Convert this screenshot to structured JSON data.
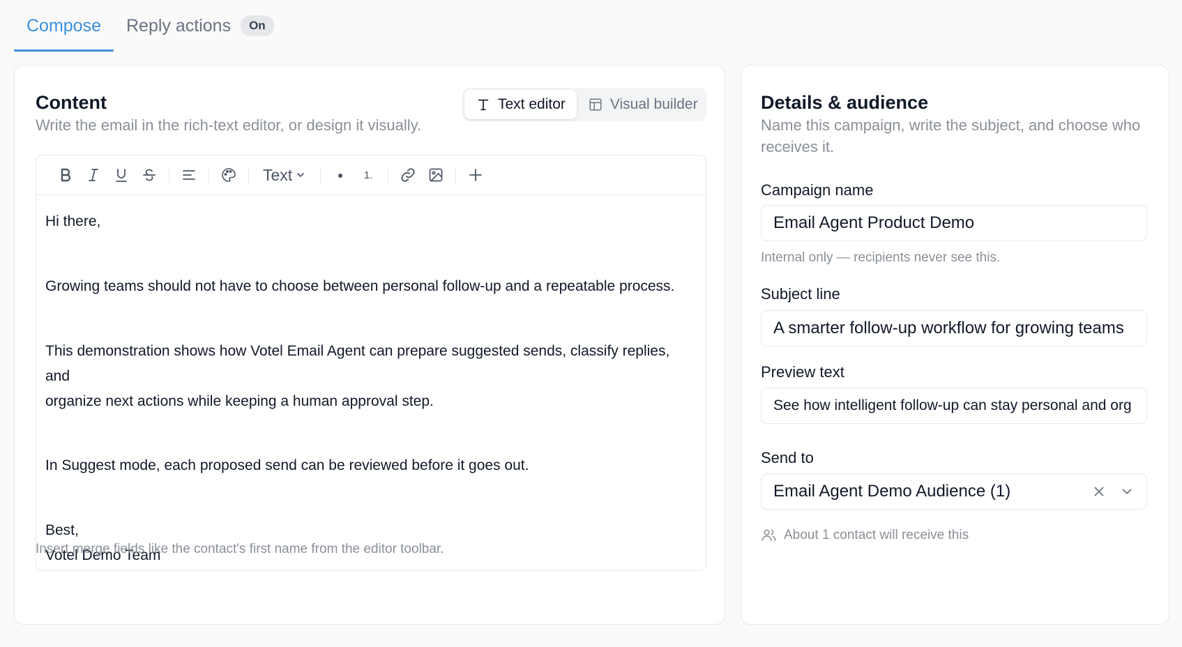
{
  "tabs": {
    "compose": "Compose",
    "reply_actions": "Reply actions",
    "reply_badge": "On"
  },
  "content": {
    "title": "Content",
    "subtitle": "Write the email in the rich-text editor, or design it visually.",
    "modes": {
      "text_editor": "Text editor",
      "visual_builder": "Visual builder",
      "active": "text_editor"
    },
    "toolbar": {
      "text_style": "Text",
      "ordered_list": "1."
    },
    "body": {
      "greeting": "Hi there,",
      "p1": "Growing teams should not have to choose between personal follow-up and a repeatable process.",
      "p2_line1": "This demonstration shows how Votel Email Agent can prepare suggested sends, classify replies, and",
      "p2_line2": "organize next actions while keeping a human approval step.",
      "p3": "In Suggest mode, each proposed send can be reviewed before it goes out.",
      "signoff": "Best,",
      "signature": "Votel Demo Team"
    },
    "hint": "Insert merge fields like the contact's first name from the editor toolbar."
  },
  "details": {
    "title": "Details & audience",
    "subtitle": "Name this campaign, write the subject, and choose who receives it.",
    "campaign_name": {
      "label": "Campaign name",
      "value": "Email Agent Product Demo",
      "hint": "Internal only — recipients never see this."
    },
    "subject_line": {
      "label": "Subject line",
      "value": "A smarter follow-up workflow for growing teams"
    },
    "preview_text": {
      "label": "Preview text",
      "value": "See how intelligent follow-up can stay personal and org"
    },
    "send_to": {
      "label": "Send to",
      "value": "Email Agent Demo Audience (1)",
      "hint": "About 1 contact will receive this"
    }
  },
  "colors": {
    "accent": "#3b8fdd",
    "muted_text": "#8a8f98",
    "border": "#e5e7eb"
  }
}
